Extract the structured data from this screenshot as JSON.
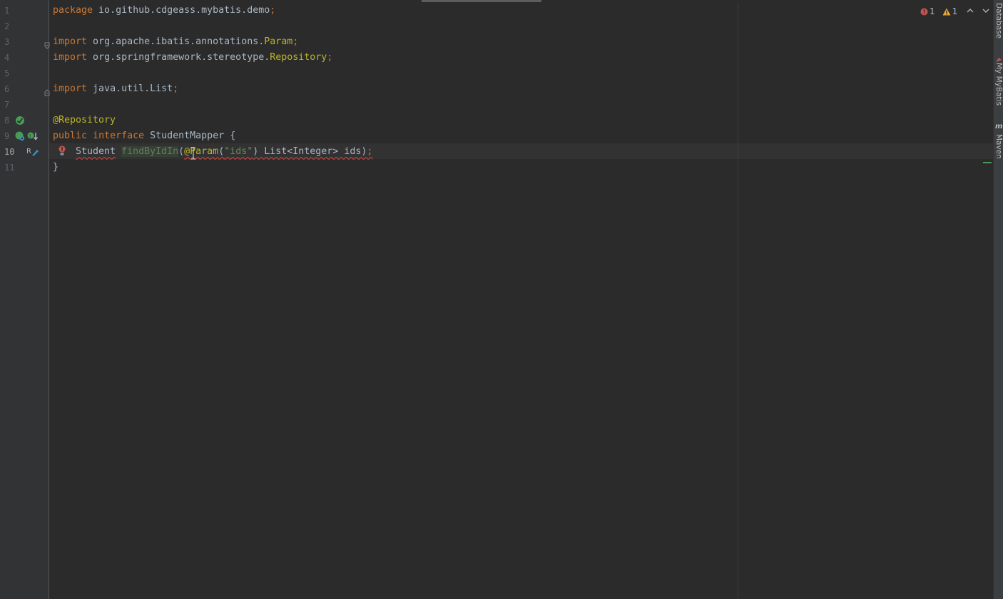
{
  "editor": {
    "lines": [
      {
        "num": "1"
      },
      {
        "num": "2"
      },
      {
        "num": "3"
      },
      {
        "num": "4"
      },
      {
        "num": "5"
      },
      {
        "num": "6"
      },
      {
        "num": "7"
      },
      {
        "num": "8"
      },
      {
        "num": "9"
      },
      {
        "num": "10"
      },
      {
        "num": "11"
      }
    ],
    "code": {
      "l1_kw": "package",
      "l1_pkg": " io.github.cdgeass.mybatis.demo",
      "l1_semi": ";",
      "l3_kw": "import",
      "l3_path": " org.apache.ibatis.annotations.",
      "l3_cls": "Param",
      "l3_semi": ";",
      "l4_kw": "import",
      "l4_path": " org.springframework.stereotype.",
      "l4_cls": "Repository",
      "l4_semi": ";",
      "l6_kw": "import",
      "l6_path": " java.util.List",
      "l6_semi": ";",
      "l8_ann": "@Repository",
      "l9_kw1": "public",
      "l9_kw2": "interface",
      "l9_name": " StudentMapper {",
      "l10_type": "Student",
      "l10_method": "findByIdIn",
      "l10_paren": "(",
      "l10_ann": "@Param",
      "l10_p1": "(",
      "l10_str": "\"ids\"",
      "l10_p2": ") List<Integer> ids)",
      "l10_semi": ";",
      "l11_brace": "}"
    }
  },
  "inspections": {
    "errors": "1",
    "warnings": "1"
  },
  "right_tool_strip": {
    "tabs": [
      "Database",
      "My MyBatis",
      "Maven"
    ]
  },
  "colors": {
    "background": "#2b2b2b",
    "keyword": "#cc7832",
    "annotation": "#bbb529",
    "string": "#6a8759",
    "text": "#a9b7c6",
    "error": "#bc3f3c"
  }
}
